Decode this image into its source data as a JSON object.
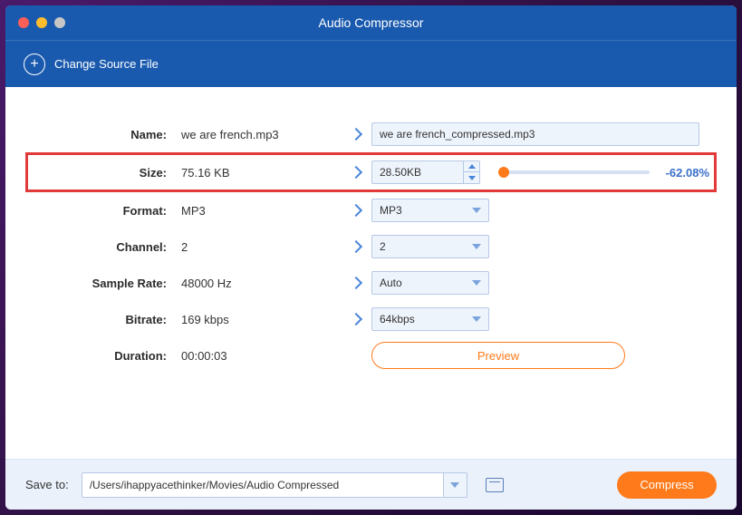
{
  "window": {
    "title": "Audio Compressor"
  },
  "toolbar": {
    "change_source": "Change Source File"
  },
  "rows": {
    "name": {
      "label": "Name:",
      "src": "we are french.mp3",
      "dest": "we are french_compressed.mp3"
    },
    "size": {
      "label": "Size:",
      "src": "75.16 KB",
      "dest": "28.50KB",
      "pct": "-62.08%"
    },
    "format": {
      "label": "Format:",
      "src": "MP3",
      "dest": "MP3"
    },
    "channel": {
      "label": "Channel:",
      "src": "2",
      "dest": "2"
    },
    "sample_rate": {
      "label": "Sample Rate:",
      "src": "48000 Hz",
      "dest": "Auto"
    },
    "bitrate": {
      "label": "Bitrate:",
      "src": "169 kbps",
      "dest": "64kbps"
    },
    "duration": {
      "label": "Duration:",
      "src": "00:00:03"
    }
  },
  "preview_label": "Preview",
  "footer": {
    "save_label": "Save to:",
    "path": "/Users/ihappyacethinker/Movies/Audio Compressed",
    "compress_label": "Compress"
  }
}
